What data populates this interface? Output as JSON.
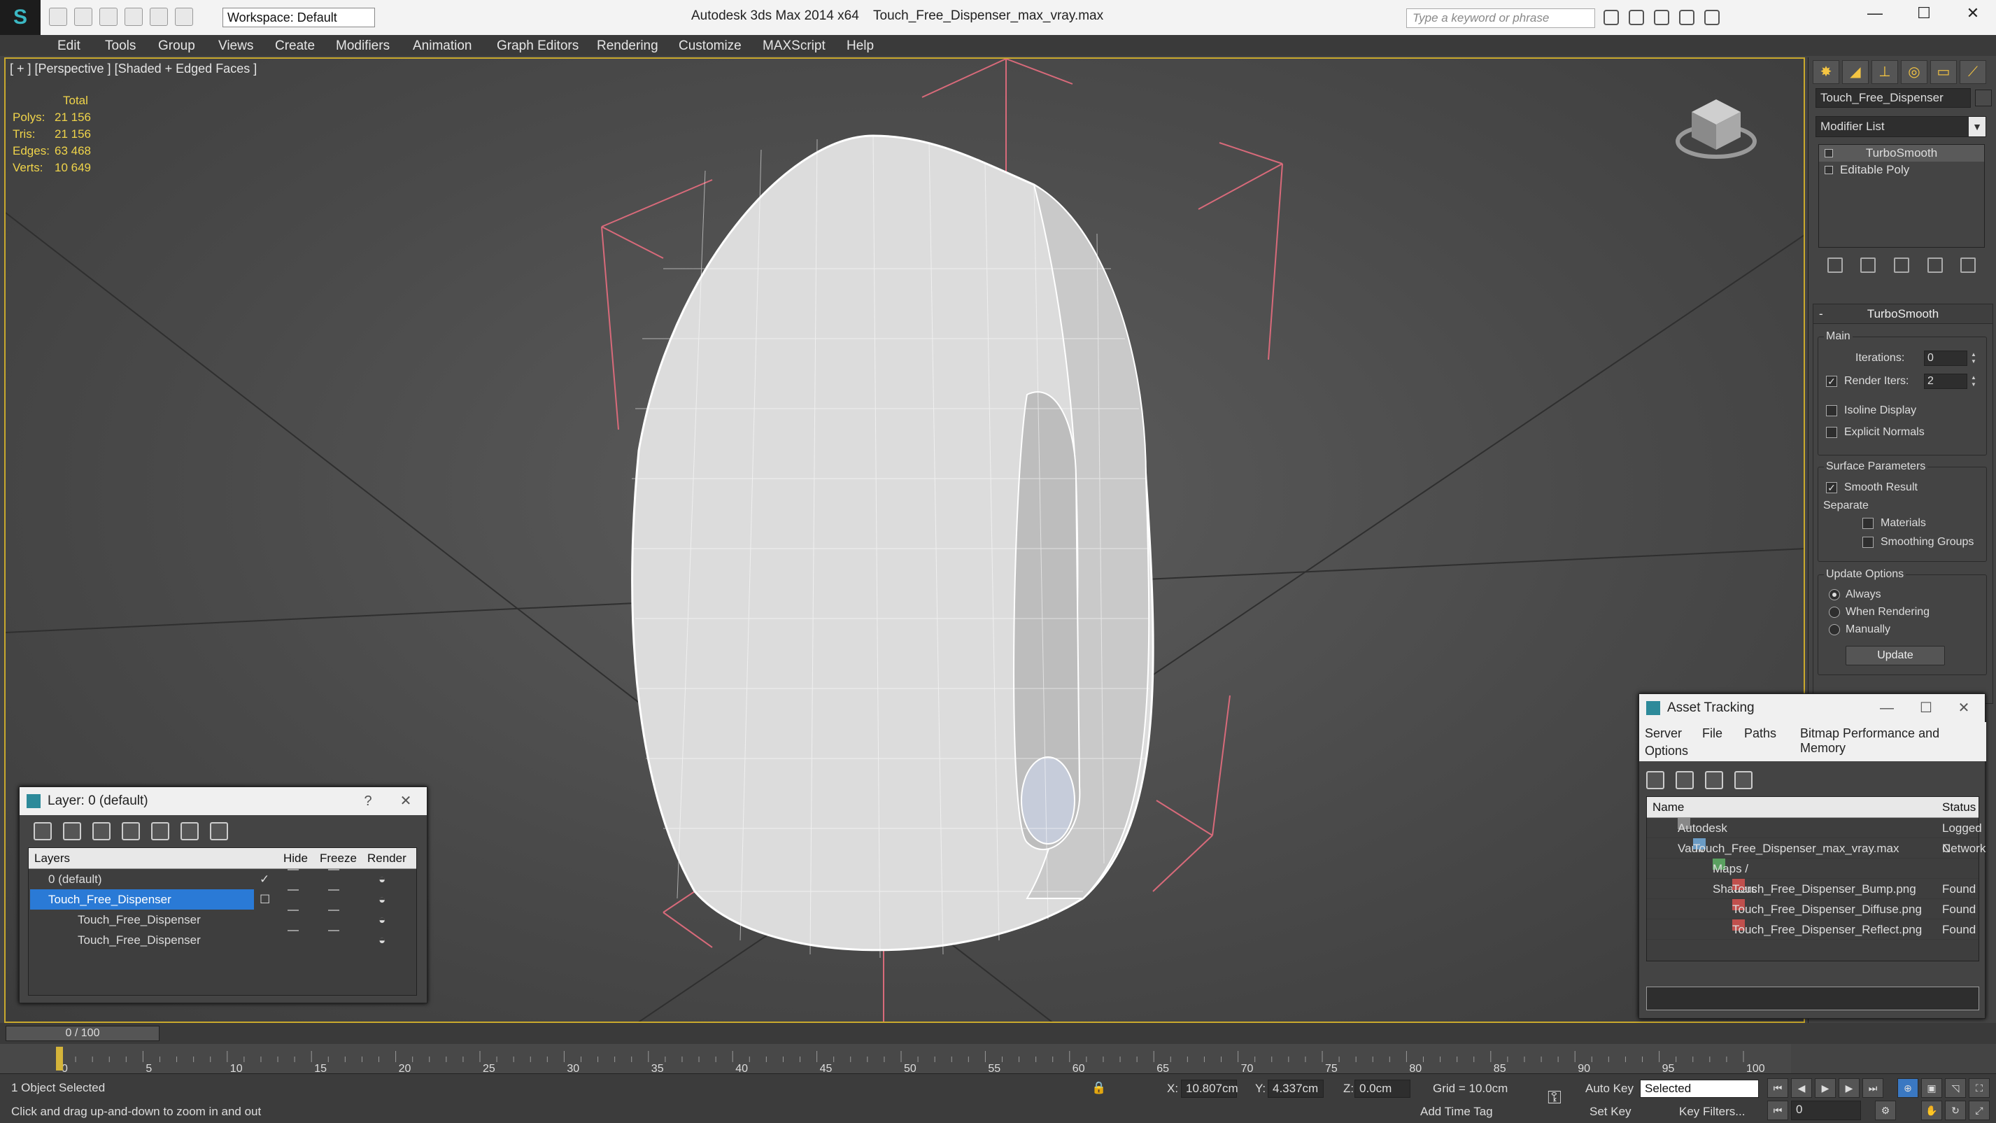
{
  "window": {
    "app_title": "Autodesk 3ds Max  2014 x64",
    "file_title": "Touch_Free_Dispenser_max_vray.max",
    "workspace": "Workspace: Default",
    "search_placeholder": "Type a keyword or phrase"
  },
  "menu": [
    "Edit",
    "Tools",
    "Group",
    "Views",
    "Create",
    "Modifiers",
    "Animation",
    "Graph Editors",
    "Rendering",
    "Customize",
    "MAXScript",
    "Help"
  ],
  "viewport": {
    "label": "[ + ] [Perspective ] [Shaded + Edged Faces ]",
    "stats": {
      "header": "Total",
      "rows": [
        {
          "k": "Polys:",
          "v": "21 156"
        },
        {
          "k": "Tris:",
          "v": "21 156"
        },
        {
          "k": "Edges:",
          "v": "63 468"
        },
        {
          "k": "Verts:",
          "v": "10 649"
        }
      ]
    }
  },
  "command_panel": {
    "object_name": "Touch_Free_Dispenser",
    "modifier_list": "Modifier List",
    "stack": [
      "TurboSmooth",
      "Editable Poly"
    ],
    "rollout": {
      "title": "TurboSmooth",
      "main": "Main",
      "iterations_label": "Iterations:",
      "iterations": "0",
      "render_iters_label": "Render Iters:",
      "render_iters": "2",
      "isoline": "Isoline Display",
      "explicit": "Explicit Normals",
      "surface": "Surface Parameters",
      "smooth": "Smooth Result",
      "separate": "Separate",
      "materials": "Materials",
      "smoothing": "Smoothing Groups",
      "update_opts": "Update Options",
      "always": "Always",
      "when_rendering": "When Rendering",
      "manually": "Manually",
      "update": "Update"
    }
  },
  "layer_dialog": {
    "title": "Layer: 0 (default)",
    "help": "?",
    "close": "✕",
    "headers": {
      "layers": "Layers",
      "hide": "Hide",
      "freeze": "Freeze",
      "render": "Render"
    },
    "rows": [
      "0 (default)",
      "Touch_Free_Dispenser",
      "Touch_Free_Dispenser",
      "Touch_Free_Dispenser"
    ]
  },
  "asset_dialog": {
    "title": "Asset Tracking",
    "menu": [
      "Server",
      "File",
      "Paths",
      "Bitmap Performance and Memory"
    ],
    "menu2": "Options",
    "headers": {
      "name": "Name",
      "status": "Status"
    },
    "rows": [
      {
        "name": "Autodesk Vault",
        "status": "Logged C"
      },
      {
        "name": "Touch_Free_Dispenser_max_vray.max",
        "status": "Network"
      },
      {
        "name": "Maps / Shaders",
        "status": ""
      },
      {
        "name": "Touch_Free_Dispenser_Bump.png",
        "status": "Found"
      },
      {
        "name": "Touch_Free_Dispenser_Diffuse.png",
        "status": "Found"
      },
      {
        "name": "Touch_Free_Dispenser_Reflect.png",
        "status": "Found"
      }
    ]
  },
  "timeline": {
    "slider": "0 / 100",
    "ticks": [
      "0",
      "5",
      "10",
      "15",
      "20",
      "25",
      "30",
      "35",
      "40",
      "45",
      "50",
      "55",
      "60",
      "65",
      "70",
      "75",
      "80",
      "85",
      "90",
      "95",
      "100"
    ]
  },
  "status": {
    "selected": "1 Object Selected",
    "hint": "Click and drag up-and-down to zoom in and out",
    "x_label": "X:",
    "x": "10.807cm",
    "y_label": "Y:",
    "y": "4.337cm",
    "z_label": "Z:",
    "z": "0.0cm",
    "grid": "Grid = 10.0cm",
    "auto_key": "Auto Key",
    "set_key": "Set Key",
    "selected_dd": "Selected",
    "key_filters": "Key Filters...",
    "add_time_tag": "Add Time Tag",
    "frame": "0"
  }
}
